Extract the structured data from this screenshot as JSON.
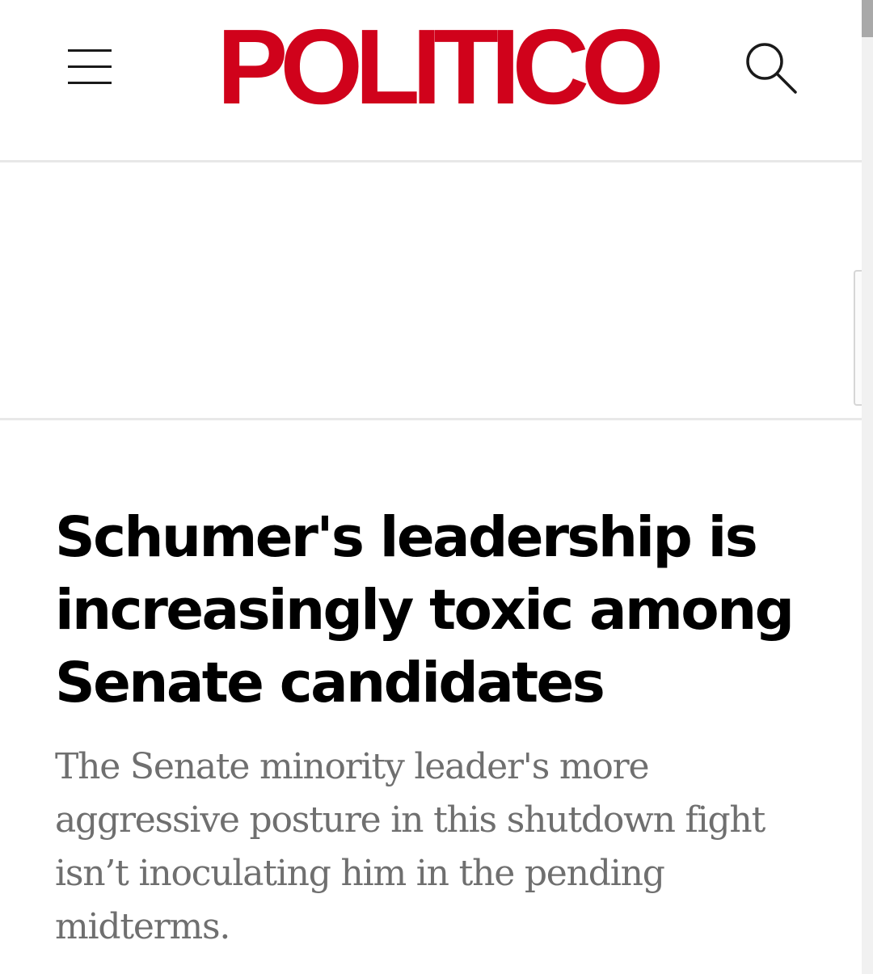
{
  "header": {
    "logo_text": "POLITICO",
    "menu_icon": "hamburger-menu-icon",
    "search_icon": "search-icon",
    "brand_color": "#d0021b"
  },
  "article": {
    "headline": "Schumer's leadership is increasingly toxic among Senate candidates",
    "dek": "The Senate minority leader's more aggressive posture in this shutdown fight isn’t inoculating him in the pending midterms."
  }
}
